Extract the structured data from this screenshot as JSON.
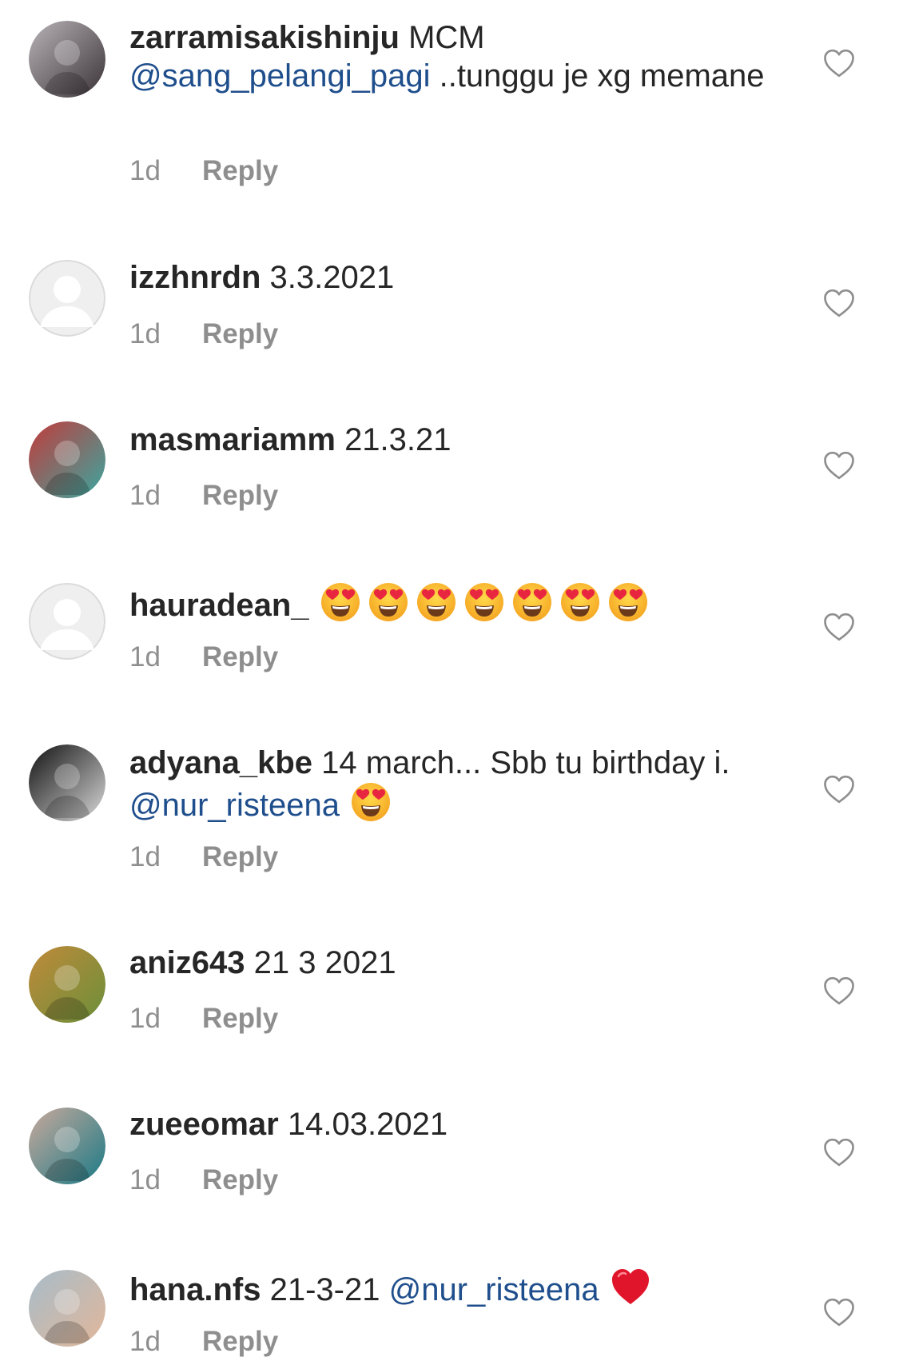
{
  "comments": [
    {
      "username": "zarramisakishinju",
      "text_before": "MCM",
      "mention": "@sang_pelangi_pagi",
      "text_after": "..tunggu je xg memane",
      "emojis": [],
      "time": "1d",
      "reply_label": "Reply",
      "avatar_colors": [
        "#b9b4b8",
        "#3a3236"
      ]
    },
    {
      "username": "izzhnrdn",
      "text_before": "3.3.2021",
      "time": "1d",
      "reply_label": "Reply",
      "avatar": "default-avatar"
    },
    {
      "username": "masmariamm",
      "text_before": "21.3.21",
      "time": "1d",
      "reply_label": "Reply",
      "avatar_colors": [
        "#c23b3b",
        "#3aa7a0"
      ]
    },
    {
      "username": "hauradean_",
      "emojis": [
        "heart-eyes-emoji",
        "heart-eyes-emoji",
        "heart-eyes-emoji",
        "heart-eyes-emoji",
        "heart-eyes-emoji",
        "heart-eyes-emoji",
        "heart-eyes-emoji"
      ],
      "time": "1d",
      "reply_label": "Reply",
      "avatar": "default-avatar"
    },
    {
      "username": "adyana_kbe",
      "text_before": "14 march... Sbb tu birthday i.",
      "mention": "@nur_risteena",
      "emojis": [
        "heart-eyes-emoji"
      ],
      "time": "1d",
      "reply_label": "Reply",
      "avatar_colors": [
        "#111111",
        "#d9d9d9"
      ]
    },
    {
      "username": "aniz643",
      "text_before": "21 3 2021",
      "time": "1d",
      "reply_label": "Reply",
      "avatar_colors": [
        "#c08a3a",
        "#6b8f3a"
      ]
    },
    {
      "username": "zueeomar",
      "text_before": "14.03.2021",
      "time": "1d",
      "reply_label": "Reply",
      "avatar_colors": [
        "#c9a99c",
        "#1a7a86"
      ]
    },
    {
      "username": "hana.nfs",
      "text_before": "21-3-21",
      "mention": "@nur_risteena",
      "emojis": [
        "red-heart-emoji"
      ],
      "time": "1d",
      "reply_label": "Reply",
      "avatar_colors": [
        "#a7bcc9",
        "#e2b79a"
      ]
    }
  ],
  "colors": {
    "text": "#262626",
    "meta": "#8e8e8e",
    "mention": "#1f4e8c",
    "heart_outline": "#8e8e8e"
  },
  "icons": {
    "like": "heart-outline-icon"
  }
}
